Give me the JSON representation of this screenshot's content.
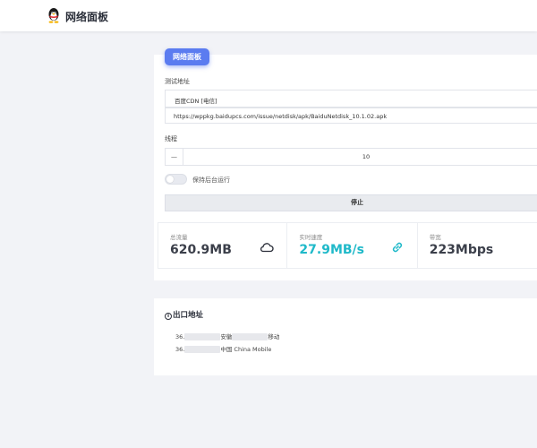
{
  "app": {
    "title": "网络面板"
  },
  "card": {
    "badge": "网络面板",
    "test_address_label": "测试地址",
    "cdn_select_value": "百度CDN [电信]",
    "url_value": "https://wppkg.baidupcs.com/issue/netdisk/apk/BaiduNetdisk_10.1.02.apk",
    "threads_label": "线程",
    "stepper_minus": "—",
    "threads_value": "10",
    "background_toggle_label": "保持后台运行",
    "background_toggle_on": false,
    "stop_button": "停止"
  },
  "stats": [
    {
      "label": "总流量",
      "value": "620.9MB",
      "color": "#3b3f4a",
      "icon": "cloud-icon"
    },
    {
      "label": "实时速度",
      "value": "27.9MB/s",
      "color": "#1fb9c9",
      "icon": "link-icon"
    },
    {
      "label": "带宽",
      "value": "223Mbps",
      "color": "#3b3f4a",
      "icon": ""
    }
  ],
  "exit": {
    "title": "出口地址",
    "rows": [
      {
        "prefix": "36.",
        "part1": "安徽",
        "part2": "移动"
      },
      {
        "prefix": "36.",
        "part1": "中国 China Mobile",
        "part2": ""
      }
    ]
  },
  "colors": {
    "accent": "#5b7cf0",
    "speed": "#1fb9c9"
  }
}
